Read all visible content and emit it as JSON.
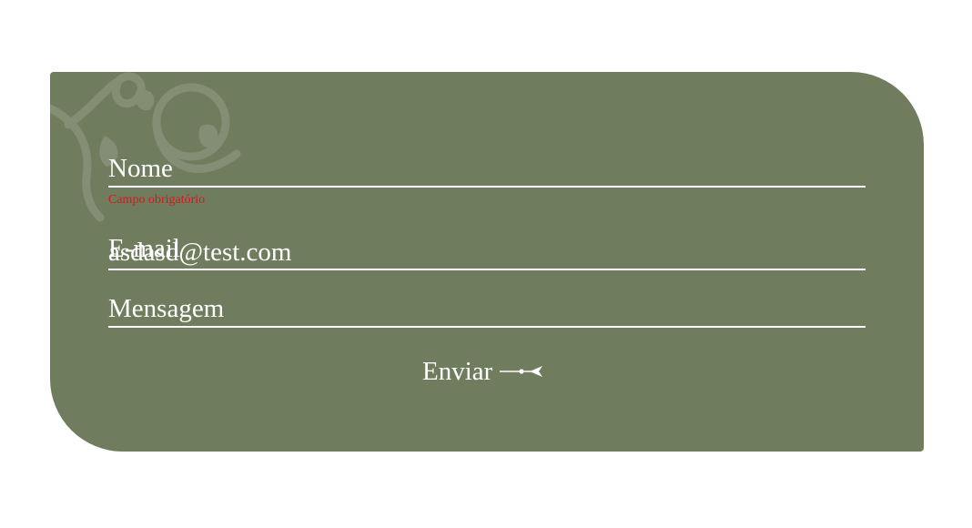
{
  "form": {
    "nome_label": "Nome",
    "nome_error": "Campo obrigatório",
    "email_label": "E-mail",
    "email_value": "asdasd@test.com",
    "mensagem_label": "Mensagem",
    "submit_label": "Enviar",
    "submit_icon": "arrow-right-icon",
    "decoration_icon": "flourish-ornament-icon"
  },
  "colors": {
    "card_background": "#6f7c5d",
    "text": "#ffffff",
    "error": "#d8161c",
    "page_background": "#ffffff"
  }
}
